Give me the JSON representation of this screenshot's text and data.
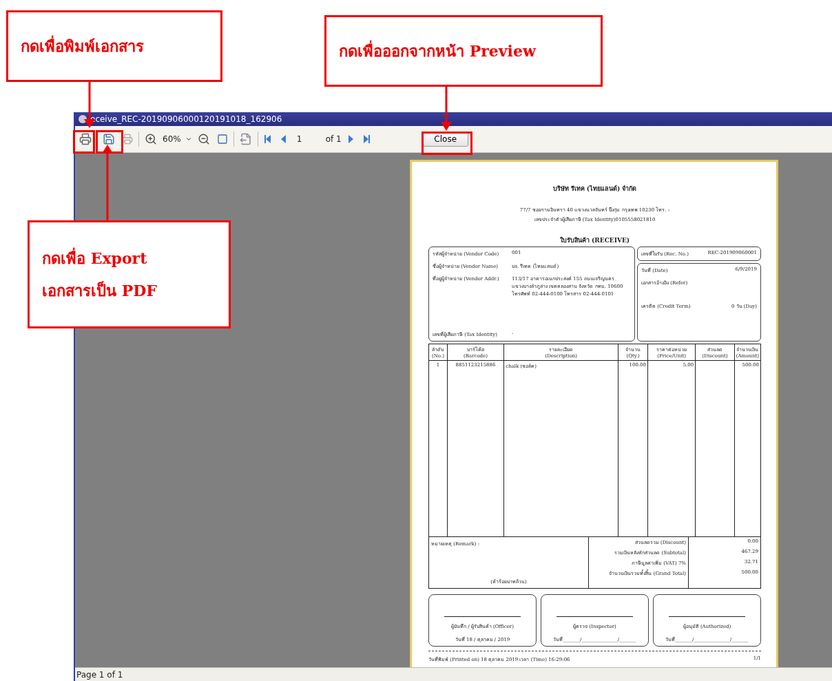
{
  "annotations": [
    {
      "lines": [
        "กดเพื่อพิมพ์เอกสาร"
      ]
    },
    {
      "lines": [
        "กดเพื่อออกจากหน้า Preview"
      ]
    },
    {
      "lines": [
        "กดเพื่อ Export",
        "เอกสารเป็น PDF"
      ]
    }
  ],
  "window": {
    "title": "eceive_REC-20190906000120191018_162906"
  },
  "toolbar": {
    "zoom": "60%",
    "page": "1",
    "page_count": "of 1",
    "close": "Close"
  },
  "document": {
    "company": "บริษัท รีเทค (ไทยแลนด์) จำกัด",
    "address": "77/7 ซอยรามอินทรา 40 แขวงนวลจันทร์ บึงกุ่ม กรุงเทพ 10230 โทร. -",
    "tax_id": "เลขประจำตัวผู้เสียภาษี (Tax Identity)0105558021810",
    "title": "ใบรับสินค้า (RECEIVE)",
    "vendor_fields": [
      {
        "label": "รหัสผู้จำหน่าย (Vendor Code)",
        "lines": [
          "001"
        ]
      },
      {
        "label": "ชื่อผู้จำหน่าย (Vendor Name)",
        "lines": [
          "บจ. รีเทค (ไทยแลนด์)"
        ]
      },
      {
        "label": "ที่อยู่ผู้จำหน่าย (Vendor Addr.)",
        "lines": [
          "113/17 อาคารอเนกประสงค์ 155 ถนนเจริญนคร",
          "แขวงบางลำภูล่าง เขตคลองสาน จังหวัด กทม. 10600",
          "โทรศัพท์ 02-444-0100   โทรสาร 02-444-0101"
        ]
      },
      {
        "label": "เลขที่ผู้เสียภาษี (Tax Identity)",
        "lines": [
          "-"
        ]
      }
    ],
    "rec_no": {
      "label": "เลขที่ใบรับ (Rec. No.)",
      "value": "REC-201909060001"
    },
    "meta": [
      {
        "label": "วันที่ (Date)",
        "value": "6/9/2019"
      },
      {
        "label": "เอกสารอ้างอิง (Refer)"
      },
      {
        "label": "เครดิต (Credit Term)",
        "value": "0     วัน (Day)"
      }
    ],
    "columns": [
      {
        "th": "ลำดับ",
        "en": "(No.)"
      },
      {
        "th": "บาร์โค้ด",
        "en": "(Barcode)"
      },
      {
        "th": "รายละเอียด",
        "en": "(Description)"
      },
      {
        "th": "จำนวน",
        "en": "(Qty.)"
      },
      {
        "th": "ราคาต่อหน่วย",
        "en": "(Price/Unit)"
      },
      {
        "th": "ส่วนลด",
        "en": "(Discount)"
      },
      {
        "th": "จำนวนเงิน",
        "en": "(Amount)"
      }
    ],
    "rows": [
      [
        "1",
        "8851123215886",
        "chalk (ชอล์ค)",
        "100.00",
        "5.00",
        "",
        "500.00"
      ]
    ],
    "remark": "หมายเหตุ (Remark) :",
    "amount_words": "(ห้าร้อยบาทถ้วน)",
    "totals": [
      {
        "label": "ส่วนลดรวม (Discount)",
        "value": "0.00"
      },
      {
        "label": "รวมเงินหลังหักส่วนลด (Subtotal)",
        "value": "467.29"
      },
      {
        "label": "ภาษีมูลค่าเพิ่ม (VAT) 7%",
        "value": "32.71"
      },
      {
        "label": "จำนวนเงินรวมทั้งสิ้น (Grand Total)",
        "value": "500.00"
      }
    ],
    "signatures": [
      {
        "role": "ผู้บันทึก / ผู้รับสินค้า (Officer)",
        "date": "วันที่  18 / ตุลาคม / 2019"
      },
      {
        "role": "ผู้ตรวจ (Inspector)",
        "date": "วันที่_______/_______________/_______"
      },
      {
        "role": "ผู้อนุมัติ (Authorized)",
        "date": "วันที่_______/_______________/_______"
      }
    ],
    "printed": "วันที่พิมพ์ (Printed on) 18 ตุลาคม 2019 เวลา (Time) 16:29:06",
    "page_no": "1/1"
  },
  "status_bar": "Page 1 of 1"
}
